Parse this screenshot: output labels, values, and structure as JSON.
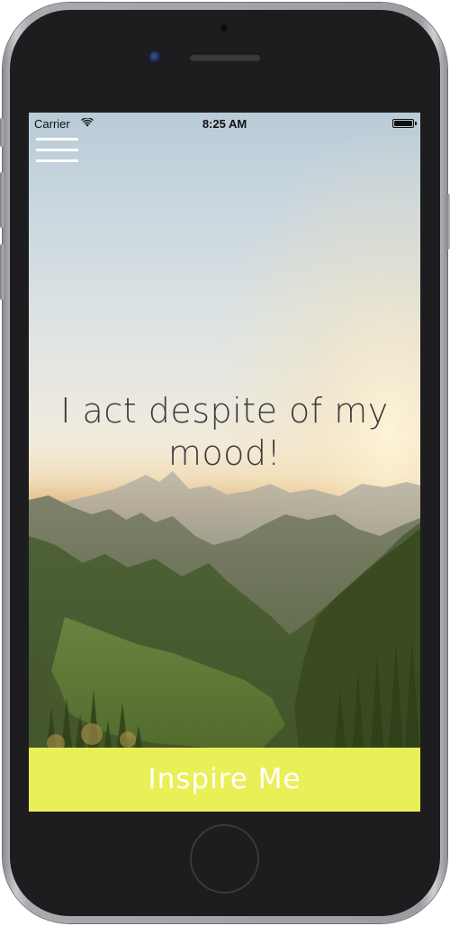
{
  "status_bar": {
    "carrier": "Carrier",
    "time": "8:25 AM",
    "wifi_icon": "wifi-icon",
    "battery_icon": "battery-full-icon",
    "battery_level": 1.0
  },
  "menu": {
    "icon": "hamburger-menu-icon"
  },
  "quote": {
    "text": "I act despite of my mood!"
  },
  "action": {
    "label": "Inspire Me",
    "background_color": "#e9ef57",
    "text_color": "#ffffff"
  },
  "background": {
    "scene": "mountain-valley-sunrise"
  }
}
